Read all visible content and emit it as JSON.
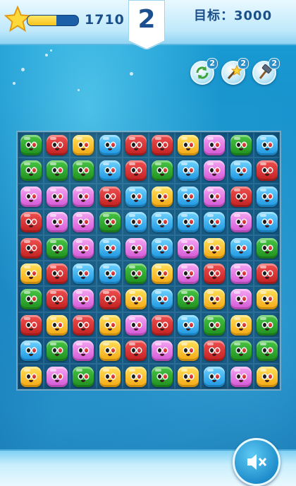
{
  "hud": {
    "score": "1710",
    "moves_left": "2",
    "target_label": "目标：3000",
    "progress_fraction": 0.57
  },
  "tools": [
    {
      "icon": "refresh-icon",
      "count": "2"
    },
    {
      "icon": "magic-wand-icon",
      "count": "2"
    },
    {
      "icon": "hammer-icon",
      "count": "2"
    }
  ],
  "board": {
    "rows": 10,
    "cols": 10,
    "color_legend": {
      "g": "green",
      "r": "red",
      "y": "yellow",
      "b": "blue",
      "p": "pink"
    },
    "grid": [
      [
        "g",
        "r",
        "y",
        "b",
        "r",
        "r",
        "y",
        "p",
        "g",
        "b"
      ],
      [
        "g",
        "g",
        "g",
        "b",
        "r",
        "g",
        "b",
        "p",
        "b",
        "r"
      ],
      [
        "p",
        "p",
        "p",
        "r",
        "b",
        "y",
        "b",
        "p",
        "r",
        "b"
      ],
      [
        "r",
        "p",
        "p",
        "g",
        "b",
        "b",
        "b",
        "b",
        "p",
        "b"
      ],
      [
        "r",
        "g",
        "p",
        "b",
        "p",
        "b",
        "p",
        "y",
        "b",
        "g"
      ],
      [
        "y",
        "r",
        "b",
        "b",
        "g",
        "y",
        "p",
        "r",
        "p",
        "r"
      ],
      [
        "g",
        "r",
        "p",
        "r",
        "y",
        "b",
        "g",
        "y",
        "p",
        "y"
      ],
      [
        "r",
        "y",
        "r",
        "y",
        "p",
        "r",
        "b",
        "g",
        "y",
        "g"
      ],
      [
        "b",
        "g",
        "p",
        "y",
        "r",
        "p",
        "y",
        "r",
        "g",
        "g"
      ],
      [
        "y",
        "p",
        "g",
        "y",
        "y",
        "g",
        "y",
        "b",
        "p",
        "y"
      ]
    ]
  },
  "sound_button": {
    "icon": "speaker-muted-icon"
  }
}
